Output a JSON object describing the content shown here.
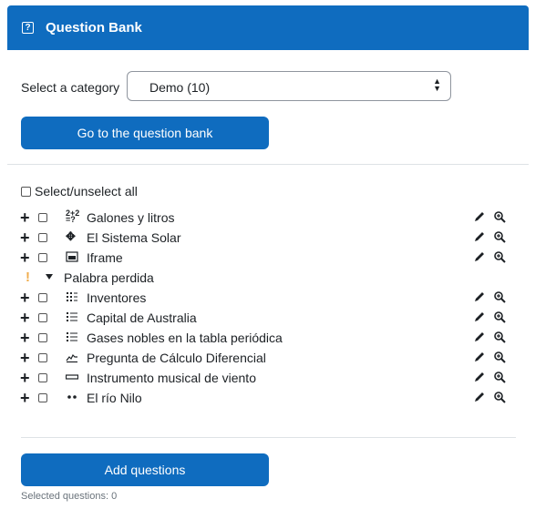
{
  "header": {
    "title": "Question Bank",
    "icon": "help-icon"
  },
  "category": {
    "label": "Select a category",
    "value": "Demo (10)"
  },
  "buttons": {
    "go_bank": "Go to the question bank",
    "add": "Add questions"
  },
  "select_all": "Select/unselect all",
  "questions": [
    {
      "name": "Galones y litros",
      "icon": "numerical-icon"
    },
    {
      "name": "El Sistema Solar",
      "icon": "drag-drop-icon"
    },
    {
      "name": "Iframe",
      "icon": "iframe-icon"
    },
    {
      "name": "Palabra perdida",
      "icon": "warning-icon",
      "group": true
    },
    {
      "name": "Inventores",
      "icon": "matching-icon"
    },
    {
      "name": "Capital de Australia",
      "icon": "multichoice-icon"
    },
    {
      "name": "Gases nobles en la tabla periódica",
      "icon": "multichoice-icon"
    },
    {
      "name": "Pregunta de Cálculo Diferencial",
      "icon": "calculated-icon"
    },
    {
      "name": "Instrumento musical de viento",
      "icon": "short-answer-icon"
    },
    {
      "name": "El río Nilo",
      "icon": "true-false-icon"
    }
  ],
  "footer": {
    "selected": "Selected questions: 0"
  }
}
